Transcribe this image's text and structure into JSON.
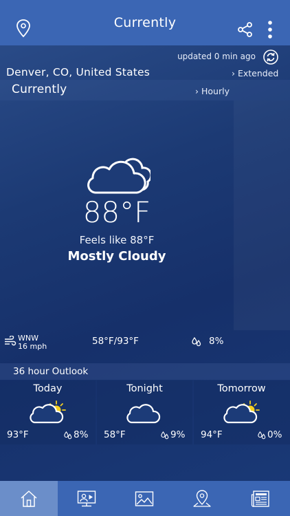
{
  "header": {
    "title": "Currently",
    "icons": [
      "location-pin-icon",
      "share-icon",
      "more-vertical-icon"
    ]
  },
  "status": {
    "updated": "updated 0 min ago"
  },
  "location": {
    "name": "Denver, CO, United States",
    "extended_label": "Extended"
  },
  "current": {
    "section_label": "Currently",
    "hourly_label": "Hourly",
    "icon": "cloud-icon",
    "temperature": "88°F",
    "feels_like": "Feels like 88°F",
    "condition": "Mostly Cloudy",
    "wind_direction": "WNW",
    "wind_speed": "16 mph",
    "hi_lo": "58°F/93°F",
    "precip": "8%"
  },
  "outlook": {
    "title": "36 hour Outlook",
    "periods": [
      {
        "label": "Today",
        "icon": "partly-sunny-icon",
        "temp": "93°F",
        "precip": "8%"
      },
      {
        "label": "Tonight",
        "icon": "partly-cloudy-night-icon",
        "temp": "58°F",
        "precip": "9%"
      },
      {
        "label": "Tomorrow",
        "icon": "partly-sunny-icon",
        "temp": "94°F",
        "precip": "0%"
      }
    ]
  },
  "bottom_nav": {
    "items": [
      "home-icon",
      "video-icon",
      "photos-icon",
      "map-icon",
      "news-icon"
    ],
    "active": "home-icon"
  },
  "colors": {
    "bar": "#3b66b4",
    "active_nav": "#6b8ec9",
    "background": "#1c3a74",
    "sun": "#f5d020"
  }
}
